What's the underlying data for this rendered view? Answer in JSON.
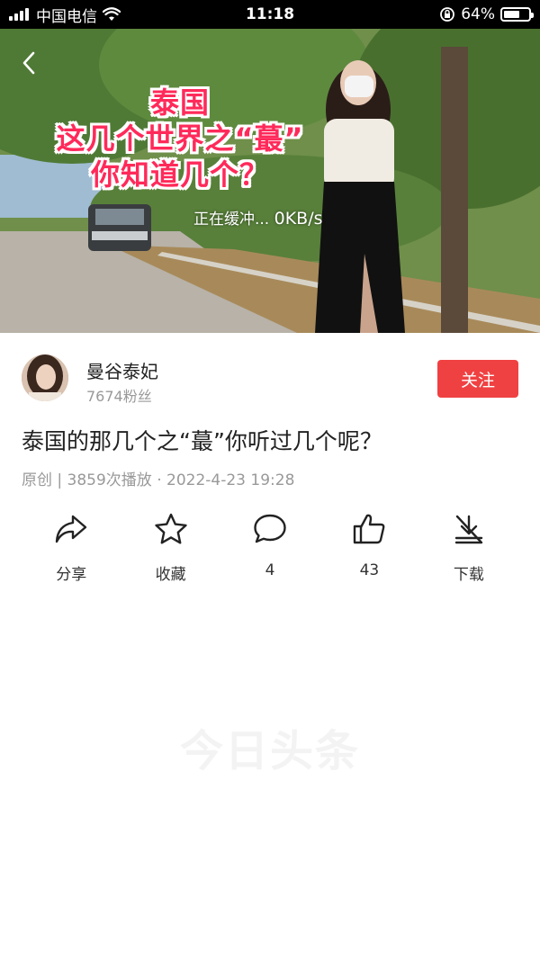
{
  "status_bar": {
    "carrier": "中国电信",
    "time": "11:18",
    "battery": "64%",
    "battery_level": 0.64
  },
  "video": {
    "overlay_title": [
      "泰国",
      "这几个世界之“蕞”",
      "你知道几个？"
    ],
    "buffering_label": "正在缓冲...",
    "buffering_speed": "0KB/s"
  },
  "author": {
    "name": "曼谷泰妃",
    "fans": "7674粉丝",
    "follow_label": "关注"
  },
  "title": "泰国的那几个之“蕞”你听过几个呢？",
  "meta": "原创 | 3859次播放 · 2022-4-23 19:28",
  "actions": [
    {
      "icon": "share-icon",
      "label": "分享"
    },
    {
      "icon": "star-icon",
      "label": "收藏"
    },
    {
      "icon": "comment-icon",
      "label": "4"
    },
    {
      "icon": "like-icon",
      "label": "43"
    },
    {
      "icon": "download-icon",
      "label": "下载"
    }
  ],
  "watermark": "今日头条"
}
